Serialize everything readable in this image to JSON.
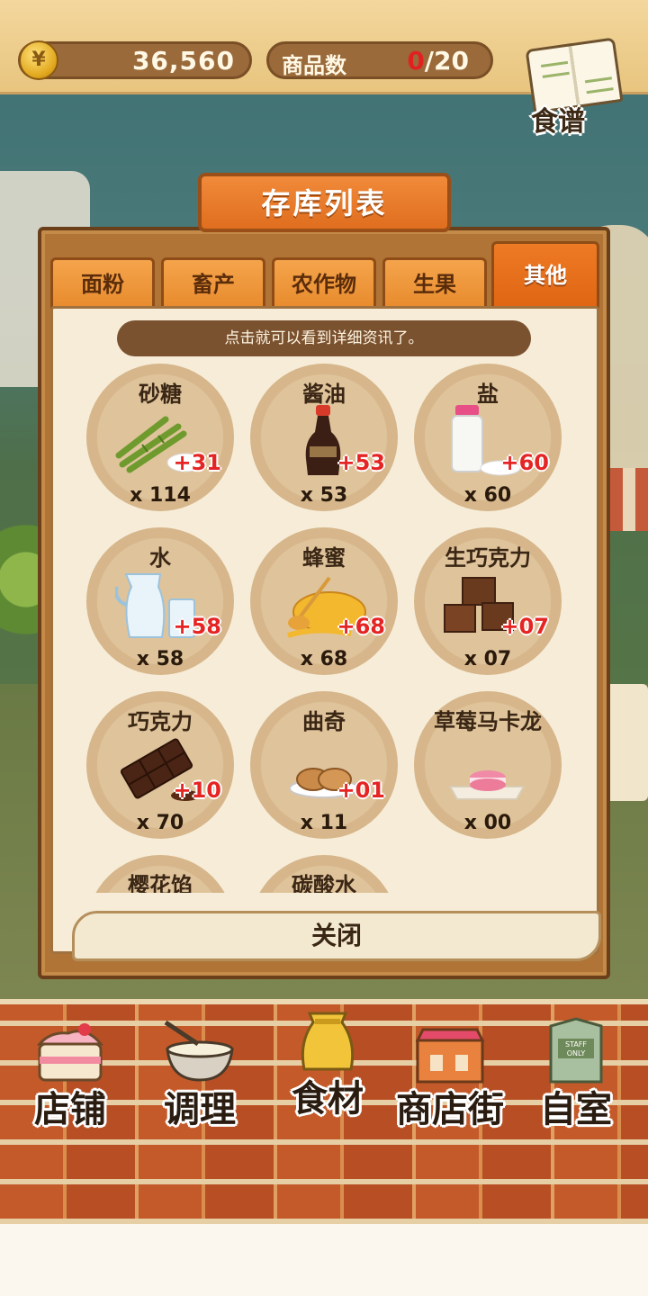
{
  "topbar": {
    "coin_symbol": "¥",
    "coins": "36,560",
    "goods_label": "商品数",
    "goods_current": "0",
    "goods_max": "/20",
    "recipe_label": "食谱"
  },
  "panel": {
    "title": "存库列表",
    "hint": "点击就可以看到详细资讯了。",
    "close_label": "关闭"
  },
  "tabs": [
    {
      "label": "面粉",
      "active": false
    },
    {
      "label": "畜产",
      "active": false
    },
    {
      "label": "农作物",
      "active": false
    },
    {
      "label": "生果",
      "active": false
    },
    {
      "label": "其他",
      "active": true
    }
  ],
  "items": [
    {
      "name": "砂糖",
      "plus": "+31",
      "qty": "x 114",
      "icon": "sugar-cane-icon"
    },
    {
      "name": "酱油",
      "plus": "+53",
      "qty": "x 53",
      "icon": "soy-sauce-bottle-icon"
    },
    {
      "name": "盐",
      "plus": "+60",
      "qty": "x 60",
      "icon": "salt-shaker-icon"
    },
    {
      "name": "水",
      "plus": "+58",
      "qty": "x 58",
      "icon": "water-pitcher-icon"
    },
    {
      "name": "蜂蜜",
      "plus": "+68",
      "qty": "x 68",
      "icon": "honey-dipper-icon"
    },
    {
      "name": "生巧克力",
      "plus": "+07",
      "qty": "x 07",
      "icon": "raw-chocolate-icon"
    },
    {
      "name": "巧克力",
      "plus": "+10",
      "qty": "x 70",
      "icon": "chocolate-bar-icon"
    },
    {
      "name": "曲奇",
      "plus": "+01",
      "qty": "x 11",
      "icon": "cookie-plate-icon"
    },
    {
      "name": "草莓马卡龙",
      "plus": "",
      "qty": "x 00",
      "icon": "strawberry-macaron-icon"
    },
    {
      "name": "樱花馅",
      "plus": "",
      "qty": "",
      "icon": "sakura-paste-icon"
    },
    {
      "name": "碳酸水",
      "plus": "",
      "qty": "",
      "icon": "soda-water-icon"
    }
  ],
  "nav": [
    {
      "label": "店铺",
      "icon": "cake-shop-icon"
    },
    {
      "label": "调理",
      "icon": "mixing-bowl-icon"
    },
    {
      "label": "食材",
      "icon": "flour-sack-icon"
    },
    {
      "label": "商店街",
      "icon": "shopping-street-icon"
    },
    {
      "label": "自室",
      "icon": "staff-only-door-icon"
    }
  ]
}
